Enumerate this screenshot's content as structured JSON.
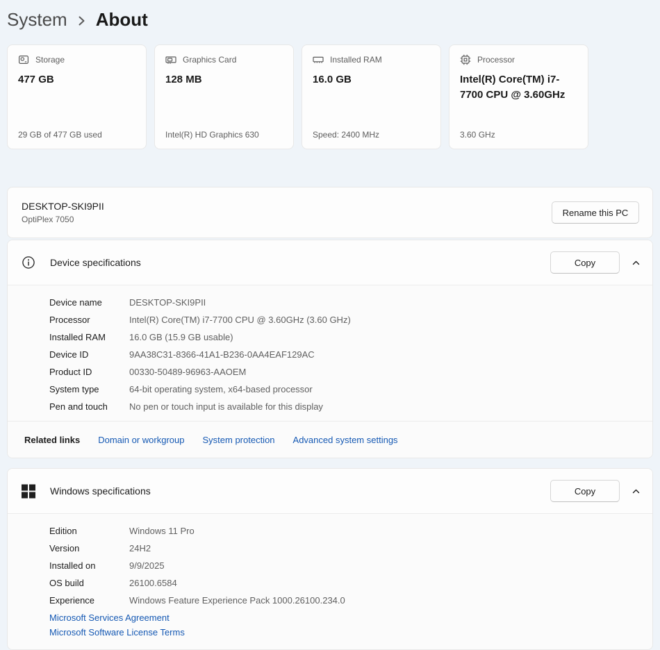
{
  "breadcrumb": {
    "parent": "System",
    "current": "About"
  },
  "cards": [
    {
      "icon": "storage-icon",
      "label": "Storage",
      "value": "477 GB",
      "detail": "29 GB of 477 GB used"
    },
    {
      "icon": "graphics-card-icon",
      "label": "Graphics Card",
      "value": "128 MB",
      "detail": "Intel(R) HD Graphics 630"
    },
    {
      "icon": "ram-icon",
      "label": "Installed RAM",
      "value": "16.0 GB",
      "detail": "Speed: 2400 MHz"
    },
    {
      "icon": "processor-icon",
      "label": "Processor",
      "value": "Intel(R) Core(TM) i7-7700 CPU @ 3.60GHz",
      "detail": "3.60 GHz"
    }
  ],
  "pc": {
    "name": "DESKTOP-SKI9PII",
    "model": "OptiPlex 7050",
    "rename_button": "Rename this PC"
  },
  "device_specs": {
    "title": "Device specifications",
    "copy_button": "Copy",
    "rows": [
      {
        "label": "Device name",
        "value": "DESKTOP-SKI9PII"
      },
      {
        "label": "Processor",
        "value": "Intel(R) Core(TM) i7-7700 CPU @ 3.60GHz (3.60 GHz)"
      },
      {
        "label": "Installed RAM",
        "value": "16.0 GB (15.9 GB usable)"
      },
      {
        "label": "Device ID",
        "value": "9AA38C31-8366-41A1-B236-0AA4EAF129AC"
      },
      {
        "label": "Product ID",
        "value": "00330-50489-96963-AAOEM"
      },
      {
        "label": "System type",
        "value": "64-bit operating system, x64-based processor"
      },
      {
        "label": "Pen and touch",
        "value": "No pen or touch input is available for this display"
      }
    ],
    "related_links": {
      "label": "Related links",
      "links": [
        "Domain or workgroup",
        "System protection",
        "Advanced system settings"
      ]
    }
  },
  "windows_specs": {
    "title": "Windows specifications",
    "copy_button": "Copy",
    "rows": [
      {
        "label": "Edition",
        "value": "Windows 11 Pro"
      },
      {
        "label": "Version",
        "value": "24H2"
      },
      {
        "label": "Installed on",
        "value": "9/9/2025"
      },
      {
        "label": "OS build",
        "value": "26100.6584"
      },
      {
        "label": "Experience",
        "value": "Windows Feature Experience Pack 1000.26100.234.0"
      }
    ],
    "links": [
      "Microsoft Services Agreement",
      "Microsoft Software License Terms"
    ]
  },
  "colors": {
    "page_bg": "#eff4f9",
    "card_bg": "#fdfdfd",
    "accent_link": "#1458b3",
    "text_primary": "#1b1b1b",
    "text_secondary": "#5d5d5d"
  }
}
